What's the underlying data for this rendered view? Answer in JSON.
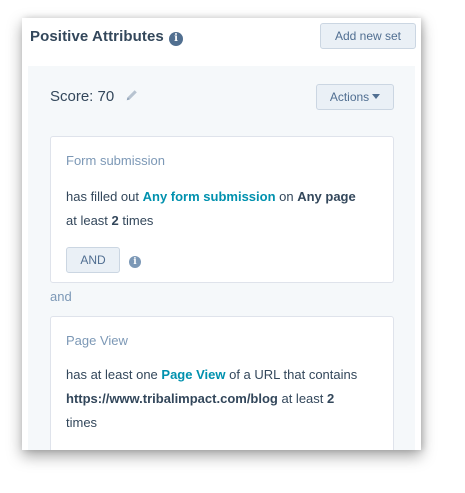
{
  "header": {
    "title": "Positive Attributes",
    "info_icon": "info-icon",
    "add_button": "Add new set"
  },
  "score": {
    "label": "Score: 70",
    "edit_icon": "pencil-icon",
    "actions_button": "Actions"
  },
  "criteria": [
    {
      "title": "Form submission",
      "text_prefix": "has filled out ",
      "link_text": "Any form submission",
      "text_middle": " on ",
      "bold_text": "Any page",
      "line2_prefix": "at least ",
      "count": "2",
      "line2_suffix": " times",
      "logic_button": "AND"
    },
    {
      "title": "Page View",
      "text_prefix": "has at least one ",
      "link_text": "Page View",
      "text_middle": " of a URL that contains",
      "bold_text": "https://www.tribalimpact.com/blog",
      "line2_prefix": " at least ",
      "count": "2",
      "line2_suffix": "times"
    }
  ],
  "connector": "and",
  "colors": {
    "text": "#33475b",
    "muted": "#7c98b6",
    "link": "#0091ae",
    "button_bg": "#eaf0f6",
    "block_bg": "#f5f8fa",
    "accent": "#00a4bd"
  }
}
